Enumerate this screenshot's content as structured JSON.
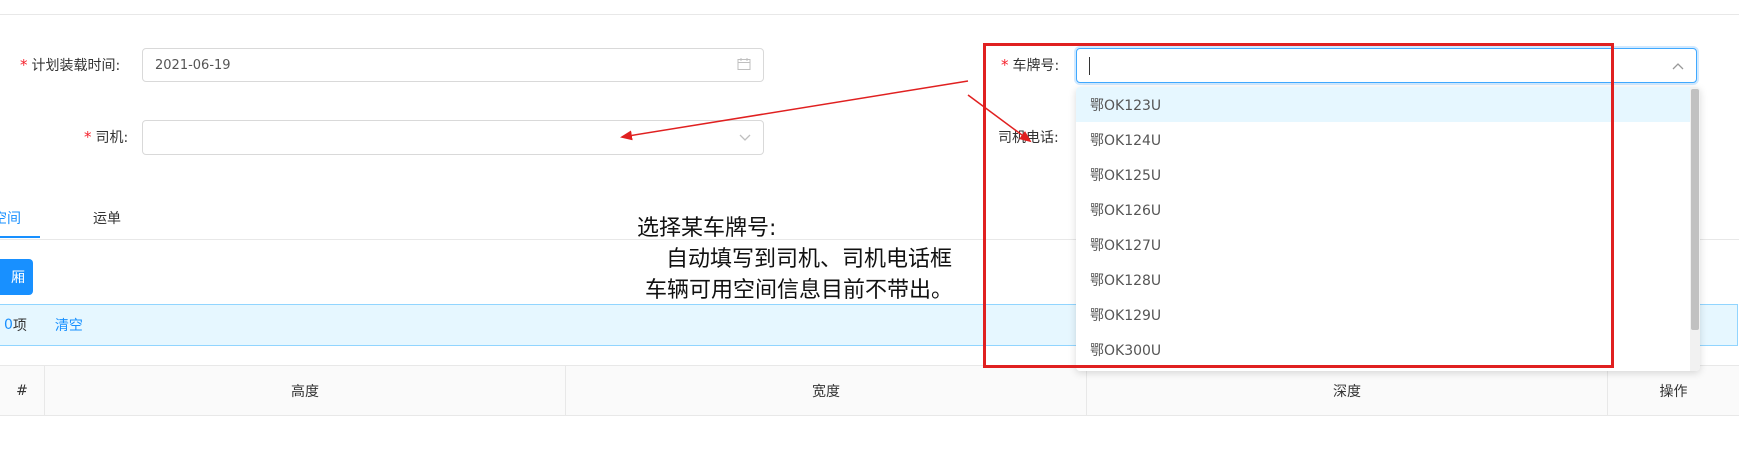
{
  "form": {
    "plan_date_label": "计划装载时间:",
    "plan_date_value": "2021-06-19",
    "driver_label": "司机:",
    "driver_value": "",
    "plate_label": "车牌号:",
    "plate_value": "",
    "driver_phone_label": "司机电话:"
  },
  "tabs": [
    {
      "label": "空间",
      "active": true
    },
    {
      "label": "运单",
      "active": false
    }
  ],
  "toolbar": {
    "add_button_label": "厢"
  },
  "selection_alert": {
    "count": "0",
    "count_suffix": "项",
    "clear_label": "清空"
  },
  "table": {
    "columns": [
      "#",
      "高度",
      "宽度",
      "深度",
      "操作"
    ]
  },
  "plate_dropdown": {
    "options": [
      "鄂OK123U",
      "鄂OK124U",
      "鄂OK125U",
      "鄂OK126U",
      "鄂OK127U",
      "鄂OK128U",
      "鄂OK129U",
      "鄂OK300U"
    ],
    "hovered_index": 0
  },
  "annotation": {
    "line1": "选择某车牌号:",
    "line2": "自动填写到司机、司机电话框",
    "line3": "车辆可用空间信息目前不带出。"
  },
  "colors": {
    "accent": "#1890ff",
    "annotation_red": "#e02020",
    "required": "#f5222d"
  }
}
